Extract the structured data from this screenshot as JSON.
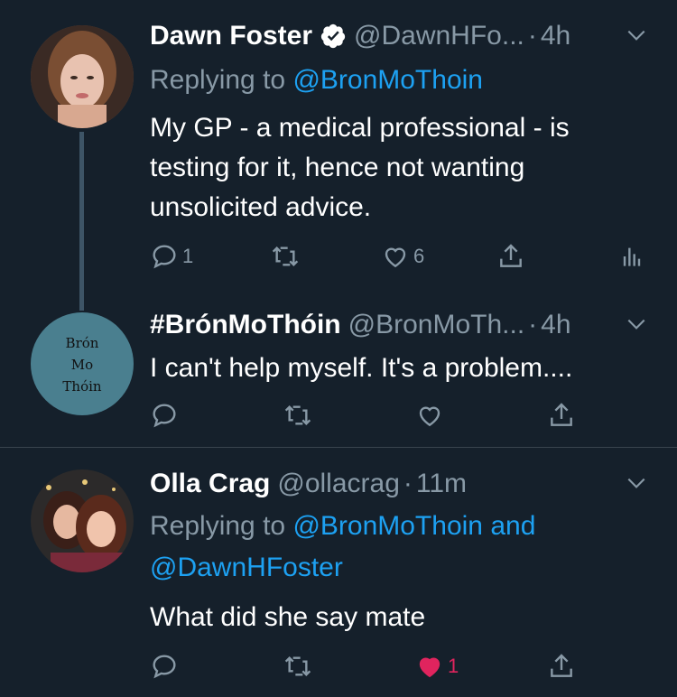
{
  "tweets": [
    {
      "name": "Dawn Foster",
      "verified": true,
      "handle": "@DawnHFo...",
      "time": "4h",
      "reply_prefix": "Replying to ",
      "reply_targets": "@BronMoThoin",
      "text_lines": [
        "My GP - a medical professional - is",
        "testing for it, hence not wanting",
        "unsolicited advice."
      ],
      "counts": {
        "replies": "1",
        "retweets": "",
        "likes": "6"
      }
    },
    {
      "name": "#BrónMoThóin",
      "handle": "@BronMoTh...",
      "time": "4h",
      "avatar_text": [
        "Brón",
        "Mo",
        "Thóin"
      ],
      "text_lines": [
        "I can't help myself. It's a problem...."
      ]
    },
    {
      "name": "Olla Crag",
      "handle": "@ollacrag",
      "time": "11m",
      "reply_prefix": "Replying to ",
      "reply_target_1": "@BronMoThoin",
      "reply_and": " and",
      "reply_target_2": "@DawnHFoster",
      "text_lines": [
        "What did she say mate"
      ],
      "counts": {
        "likes": "1"
      }
    }
  ],
  "colors": {
    "background": "#15202b",
    "link": "#1da1f2",
    "muted": "#8899a6",
    "like_active": "#e0245e"
  }
}
